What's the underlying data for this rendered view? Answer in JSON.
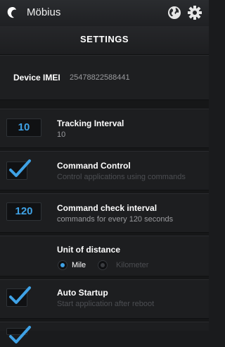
{
  "app": {
    "title": "Möbius",
    "logo_icon": "mobius-logo-icon",
    "globe_icon": "globe-icon",
    "settings_icon": "gear-icon"
  },
  "header": {
    "title": "SETTINGS"
  },
  "device": {
    "label": "Device IMEI",
    "value": "25478822588441"
  },
  "tracking_interval": {
    "value": "10",
    "title": "Tracking Interval",
    "subtitle": "10"
  },
  "command_control": {
    "checked": true,
    "title": "Command Control",
    "subtitle": "Control applications using commands"
  },
  "command_check_interval": {
    "value": "120",
    "title": "Command check interval",
    "subtitle": "commands for every 120 seconds"
  },
  "unit_of_distance": {
    "title": "Unit of distance",
    "options": [
      {
        "label": "Mile",
        "selected": true
      },
      {
        "label": "Kilometer",
        "selected": false
      }
    ]
  },
  "auto_startup": {
    "checked": true,
    "title": "Auto Startup",
    "subtitle": "Start application after reboot"
  },
  "colors": {
    "accent": "#3fa2e6",
    "background": "#1a1b1d",
    "muted_text": "#9a9b9e",
    "disabled_text": "#4c4e52"
  }
}
